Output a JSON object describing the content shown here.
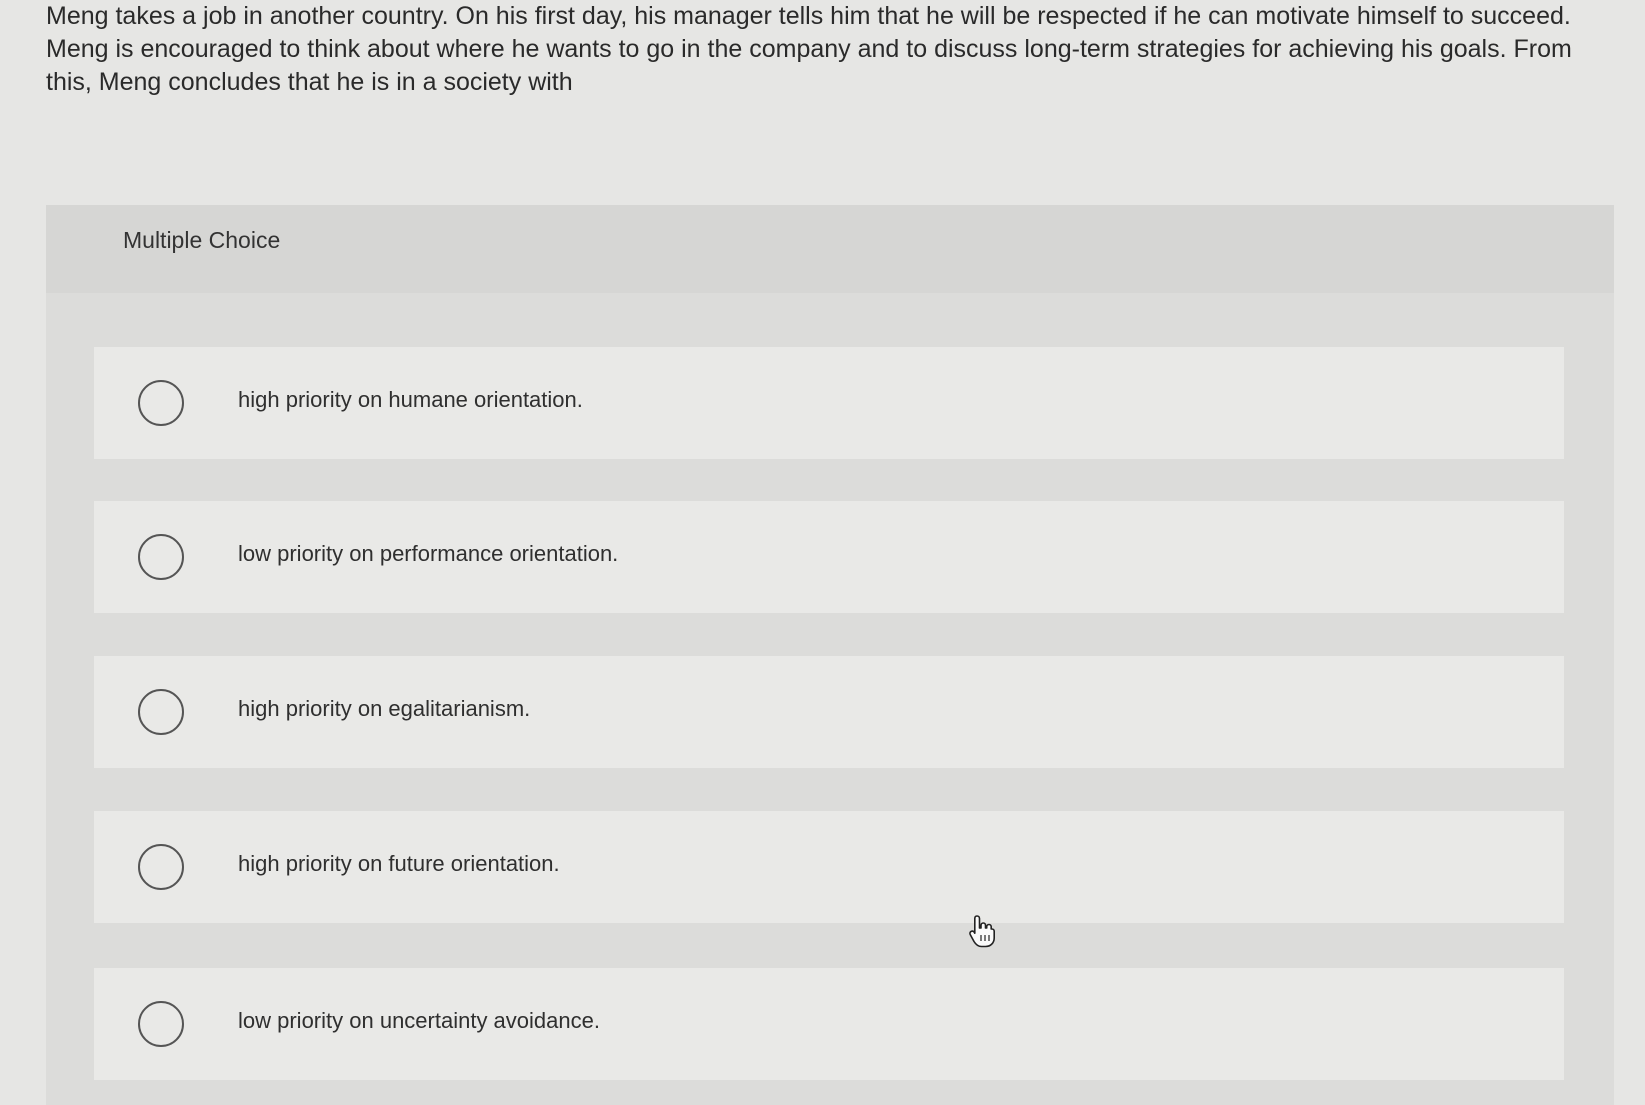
{
  "question": {
    "text": "Meng takes a job in another country. On his first day, his manager tells him that he will be respected if he can motivate himself to succeed. Meng is encouraged to think about where he wants to go in the company and to discuss long-term strategies for achieving his goals. From this, Meng concludes that he is in a society with"
  },
  "multiple_choice": {
    "label": "Multiple Choice",
    "options": [
      {
        "label": "high priority on humane orientation.",
        "selected": false
      },
      {
        "label": "low priority on performance orientation.",
        "selected": false
      },
      {
        "label": "high priority on egalitarianism.",
        "selected": false
      },
      {
        "label": "high priority on future orientation.",
        "selected": false
      },
      {
        "label": "low priority on uncertainty avoidance.",
        "selected": false
      }
    ]
  },
  "icons": {
    "cursor": "hand-pointer-icon",
    "radio": "radio-unselected-icon"
  },
  "colors": {
    "background": "#e6e6e4",
    "panel": "#dcdcda",
    "header": "#d6d6d4",
    "option": "#e9e9e7",
    "radio_border": "#555555"
  }
}
